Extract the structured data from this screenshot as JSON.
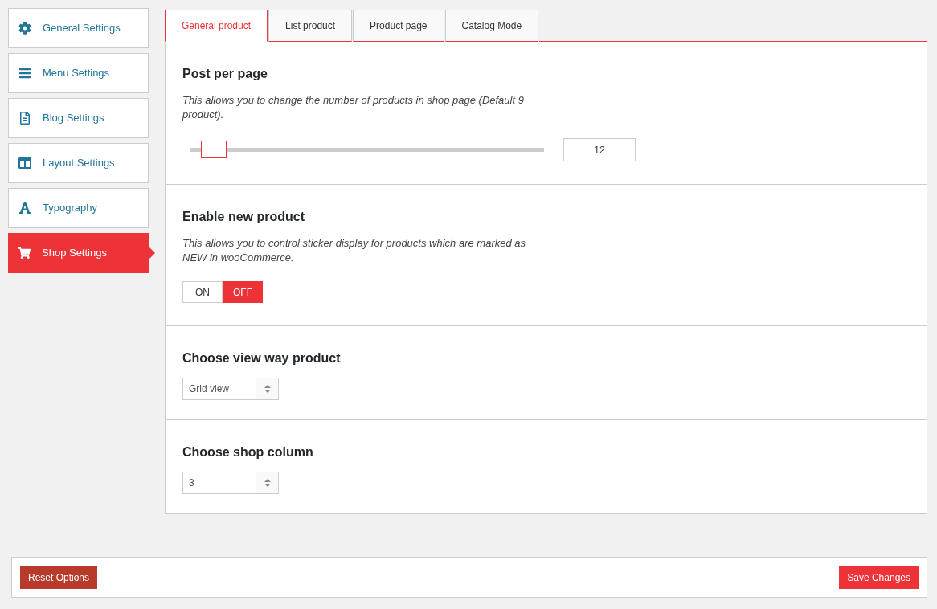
{
  "sidebar": {
    "items": [
      {
        "label": "General Settings",
        "selected": false
      },
      {
        "label": "Menu Settings",
        "selected": false
      },
      {
        "label": "Blog Settings",
        "selected": false
      },
      {
        "label": "Layout Settings",
        "selected": false
      },
      {
        "label": "Typography",
        "selected": false
      },
      {
        "label": "Shop Settings",
        "selected": true
      }
    ]
  },
  "tabs": [
    {
      "label": "General product",
      "selected": true
    },
    {
      "label": "List product",
      "selected": false
    },
    {
      "label": "Product page",
      "selected": false
    },
    {
      "label": "Catalog Mode",
      "selected": false
    }
  ],
  "sections": [
    {
      "kind": "slider",
      "title": "Post per page",
      "description": "This allows you to change the number of products in shop page (Default 9 product).",
      "level": 0.03,
      "value": "12"
    },
    {
      "kind": "toggle",
      "title": "Enable new product",
      "description": "This allows you to control sticker display for products which are marked as NEW in wooCommerce.",
      "options": [
        {
          "label": "ON",
          "selected": false
        },
        {
          "label": "OFF",
          "selected": true
        }
      ]
    },
    {
      "kind": "select",
      "title": "Choose view way product",
      "value": "Grid view"
    },
    {
      "kind": "select",
      "title": "Choose shop column",
      "value": "3"
    }
  ],
  "footer": {
    "reset": "Reset Options",
    "save": "Save Changes"
  }
}
